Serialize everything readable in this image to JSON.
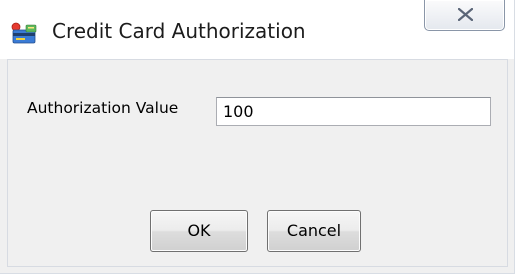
{
  "window": {
    "title": "Credit Card Authorization",
    "icon": "credit-card-app-icon",
    "close_icon": "close-x-icon"
  },
  "form": {
    "label": "Authorization Value",
    "value": "100"
  },
  "buttons": {
    "ok_label": "OK",
    "cancel_label": "Cancel"
  },
  "colors": {
    "dialog_background": "#f0f0f0",
    "titlebar_background": "#ffffff"
  }
}
